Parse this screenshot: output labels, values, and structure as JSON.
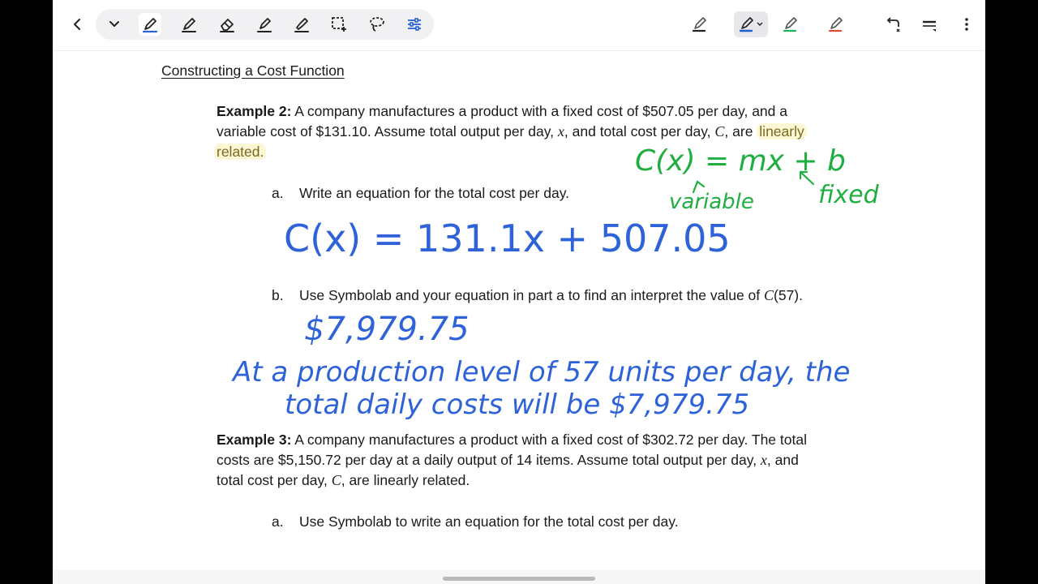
{
  "toolbar": {
    "back": "back-icon",
    "chevron": "chevron-down-icon",
    "tools": [
      "pen-tool-icon",
      "pencil-icon",
      "eraser-icon",
      "highlighter-icon",
      "marker-icon",
      "lasso-select-icon",
      "lasso-icon",
      "adjust-icon"
    ],
    "pens": [
      {
        "name": "black-pen-icon",
        "color": "#222222"
      },
      {
        "name": "blue-pen-icon",
        "color": "#1f5fd1"
      },
      {
        "name": "green-pen-icon",
        "color": "#22b35a"
      },
      {
        "name": "red-pen-icon",
        "color": "#e24a3a"
      }
    ]
  },
  "doc": {
    "title": "Constructing a Cost Function",
    "ex2": {
      "label": "Example 2:",
      "line1": " A company manufactures a product with a fixed cost of $507.05 per day, and a",
      "line2a": "variable cost of $131.10. Assume total output per day, ",
      "var_x": "x",
      "line2b": ", and total cost per day, ",
      "var_C": "C",
      "line2c": ", are ",
      "hl1": "linearly",
      "hl2": "related.",
      "a_label": "a.",
      "a_text": "Write an equation for the total cost per day.",
      "b_label": "b.",
      "b_text": "Use Symbolab and your equation in part a to find an interpret the value of ",
      "b_math": "C",
      "b_math2": "(57)."
    },
    "ex3": {
      "label": "Example 3:",
      "line1": " A company manufactures a product with a fixed cost of $302.72 per day. The total",
      "line2a": "costs are $5,150.72 per day at a daily output of 14 items. Assume total output per day, ",
      "var_x": "x",
      "line2b": ", and",
      "line3a": "total cost per day, ",
      "var_C": "C",
      "line3b": ", are linearly related.",
      "a_label": "a.",
      "a_text": "Use Symbolab to write an equation for the total cost per day."
    }
  },
  "ink": {
    "green_eq": "C(x) = mx + b",
    "green_variable": "variable",
    "green_fixed": "fixed",
    "blue_eq": "C(x) = 131.1x + 507.05",
    "blue_value": "$7,979.75",
    "blue_line1": "At a production level of 57 units per day, the",
    "blue_line2": "total daily costs will be $7,979.75",
    "colors": {
      "green": "#1fae3f",
      "blue": "#2e62d8"
    }
  }
}
